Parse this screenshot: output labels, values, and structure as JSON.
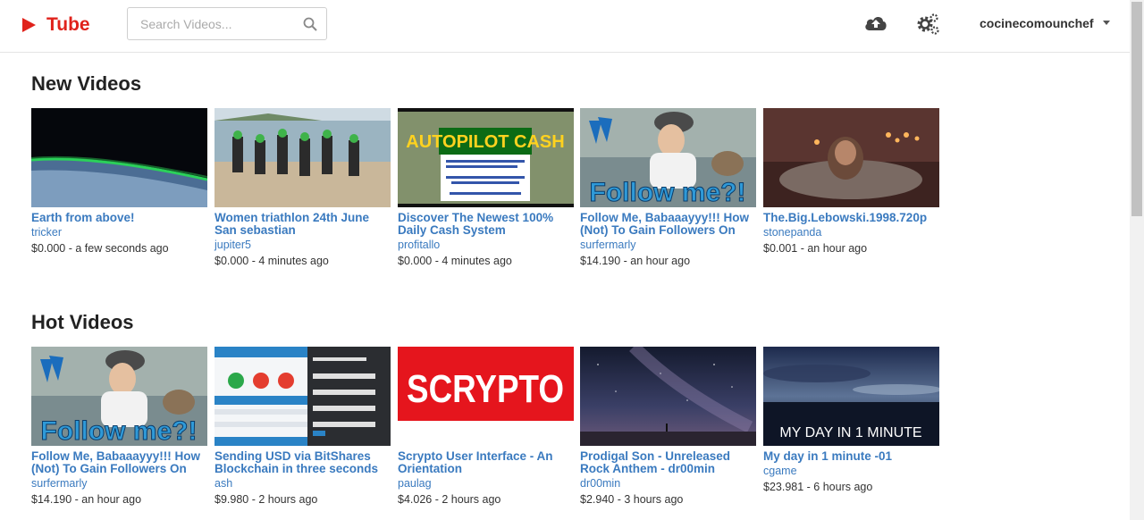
{
  "header": {
    "logo_text": "Tube",
    "search_placeholder": "Search Videos...",
    "username": "cocinecomounchef",
    "brand_color": "#e0221b"
  },
  "sections": {
    "new": {
      "title": "New Videos",
      "videos": [
        {
          "title": "Earth from above!",
          "author": "tricker",
          "meta": "$0.000 - a few seconds ago"
        },
        {
          "title": "Women triathlon 24th June San sebastian",
          "author": "jupiter5",
          "meta": "$0.000 - 4 minutes ago"
        },
        {
          "title": "Discover The Newest 100% Daily Cash System",
          "author": "profitallo",
          "meta": "$0.000 - 4 minutes ago",
          "thumb_text": "AUTOPILOT CASH"
        },
        {
          "title": "Follow Me, Babaaayyy!!! How (Not) To Gain Followers On",
          "author": "surfermarly",
          "meta": "$14.190 - an hour ago",
          "thumb_text": "Follow me?!"
        },
        {
          "title": "The.Big.Lebowski.1998.720p",
          "author": "stonepanda",
          "meta": "$0.001 - an hour ago"
        }
      ]
    },
    "hot": {
      "title": "Hot Videos",
      "videos": [
        {
          "title": "Follow Me, Babaaayyy!!! How (Not) To Gain Followers On",
          "author": "surfermarly",
          "meta": "$14.190 - an hour ago",
          "thumb_text": "Follow me?!"
        },
        {
          "title": "Sending USD via BitShares Blockchain in three seconds",
          "author": "ash",
          "meta": "$9.980 - 2 hours ago"
        },
        {
          "title": "Scrypto User Interface - An Orientation",
          "author": "paulag",
          "meta": "$4.026 - 2 hours ago",
          "thumb_text": "SCRYPTO"
        },
        {
          "title": "Prodigal Son - Unreleased Rock Anthem - dr00min",
          "author": "dr00min",
          "meta": "$2.940 - 3 hours ago"
        },
        {
          "title": "My day in 1 minute -01",
          "author": "cgame",
          "meta": "$23.981 - 6 hours ago",
          "thumb_text": "MY DAY IN 1 MINUTE"
        }
      ]
    }
  }
}
